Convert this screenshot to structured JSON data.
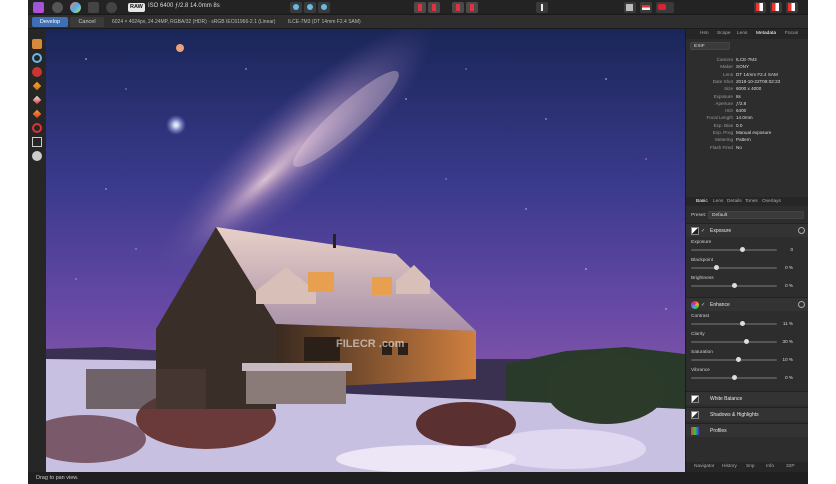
{
  "toolbar": {
    "raw_badge": "RAW",
    "exposure_info": "ISO 6400 ƒ/2.8 14.0mm 8s"
  },
  "context": {
    "tabs": [
      "Develop",
      "Cancel"
    ],
    "image_info": "6024 × 4024px, 24.24MP, RGBA/32 (HDR) · sRGB IEC61966-2.1 (Linear)",
    "lens_info": "ILCE-7M3 (DT 14mm F2.4 SAM)"
  },
  "panel": {
    "top_tabs": [
      "Hsn",
      "Scope",
      "Lens",
      "Metadata",
      "Focus"
    ],
    "exif_select": "EXIF",
    "metadata": [
      {
        "k": "Camera",
        "v": "ILCE-7M3"
      },
      {
        "k": "Maker",
        "v": "SONY"
      },
      {
        "k": "Lens",
        "v": "DT 14mm F2.4 SAM"
      },
      {
        "k": "Date Shot",
        "v": "2018-10-22T08:02:23"
      },
      {
        "k": "Size",
        "v": "6000 x 4000"
      },
      {
        "k": "Exposure",
        "v": "8s"
      },
      {
        "k": "Aperture",
        "v": "ƒ/2.8"
      },
      {
        "k": "ISO",
        "v": "6400"
      },
      {
        "k": "Focal Length",
        "v": "14.0mm"
      },
      {
        "k": "Exp. Bias",
        "v": "0.0"
      },
      {
        "k": "Exp. Prog",
        "v": "Manual exposure"
      },
      {
        "k": "Metering",
        "v": "Pattern"
      },
      {
        "k": "Flash Fired",
        "v": "No"
      }
    ],
    "basic_tabs": [
      "Basic",
      "Lens",
      "Details",
      "Tones",
      "Overlays"
    ],
    "preset_label": "Preset:",
    "preset_value": "Default",
    "exposure_section": {
      "title": "Exposure",
      "sliders": [
        {
          "label": "Exposure",
          "value": "0",
          "pos": 0.6
        },
        {
          "label": "Blackpoint",
          "value": "0 %",
          "pos": 0.3
        },
        {
          "label": "Brightness",
          "value": "0 %",
          "pos": 0.5
        }
      ]
    },
    "enhance_section": {
      "title": "Enhance",
      "sliders": [
        {
          "label": "Contrast",
          "value": "11 %",
          "pos": 0.6
        },
        {
          "label": "Clarity",
          "value": "30 %",
          "pos": 0.65
        },
        {
          "label": "Saturation",
          "value": "10 %",
          "pos": 0.55
        },
        {
          "label": "Vibrance",
          "value": "0 %",
          "pos": 0.5
        }
      ]
    },
    "collapsed_sections": [
      "White Balance",
      "Shadows & Highlights",
      "Profiles"
    ],
    "bottom_tabs": [
      "Navigator",
      "History",
      "Snp",
      "Info",
      "32P"
    ]
  },
  "status": {
    "text": "Drag to pan view."
  },
  "watermark": "FILECR .com"
}
